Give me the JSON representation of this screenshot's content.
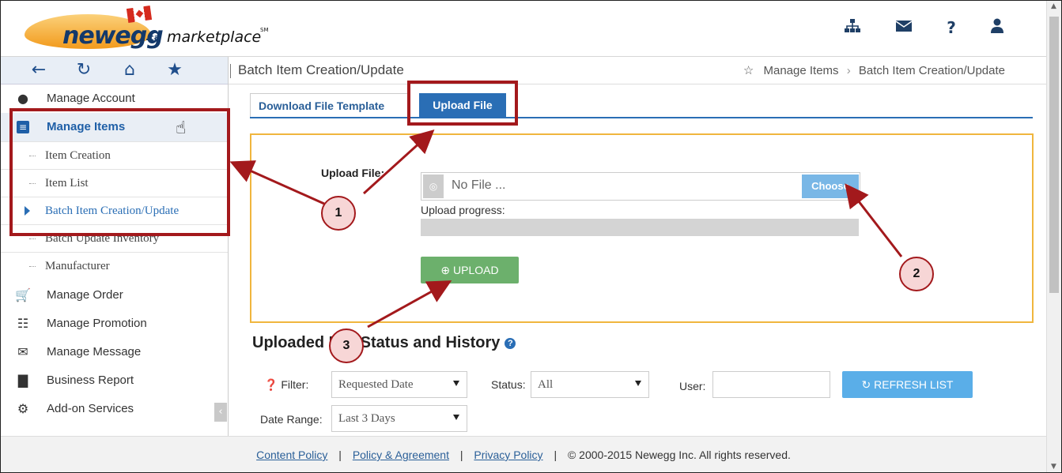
{
  "header": {
    "logo": {
      "brand": "newegg",
      "tld": ".ca",
      "product": "marketplace",
      "mark": "SM"
    },
    "icons": [
      "sitemap-icon",
      "envelope-icon",
      "help-icon",
      "user-icon"
    ]
  },
  "sidebar": {
    "nav_icons": [
      "back-icon",
      "refresh-icon",
      "home-icon",
      "star-icon"
    ],
    "menu": [
      {
        "label": "Manage Account",
        "icon": "user-icon"
      },
      {
        "label": "Manage Items",
        "icon": "list-icon",
        "active": true
      },
      {
        "label": "Manage Order",
        "icon": "cart-icon"
      },
      {
        "label": "Manage Promotion",
        "icon": "gift-icon"
      },
      {
        "label": "Manage Message",
        "icon": "envelope-icon"
      },
      {
        "label": "Business Report",
        "icon": "bar-chart-icon"
      },
      {
        "label": "Add-on Services",
        "icon": "cogs-icon"
      }
    ],
    "subitems": [
      {
        "label": "Item Creation"
      },
      {
        "label": "Item List"
      },
      {
        "label": "Batch Item Creation/Update",
        "current": true
      },
      {
        "label": "Batch Update Inventory"
      },
      {
        "label": "Manufacturer"
      }
    ]
  },
  "page": {
    "title": "Batch Item Creation/Update",
    "breadcrumb": [
      "Manage Items",
      "Batch Item Creation/Update"
    ]
  },
  "tabs": [
    {
      "label": "Download File Template",
      "active": false
    },
    {
      "label": "Upload File",
      "active": true
    }
  ],
  "upload": {
    "label": "Upload File:",
    "file_placeholder": "No File ...",
    "choose_label": "Choose",
    "progress_label": "Upload progress:",
    "progress": 0,
    "upload_button": "UPLOAD"
  },
  "history": {
    "title": "Uploaded File Status and History",
    "filter_label": "Filter:",
    "filter_value": "Requested Date",
    "status_label": "Status:",
    "status_value": "All",
    "user_label": "User:",
    "user_value": "",
    "refresh_label": "REFRESH LIST",
    "date_range_label": "Date Range:",
    "date_range_value": "Last 3 Days"
  },
  "footer": {
    "links": [
      "Content Policy",
      "Policy & Agreement",
      "Privacy Policy"
    ],
    "copyright": "© 2000-2015 Newegg Inc. All rights reserved."
  },
  "annotations": {
    "step1": "1",
    "step2": "2",
    "step3": "3"
  },
  "colors": {
    "brand_blue": "#2a6eb5",
    "highlight_red": "#a3191c",
    "panel_border": "#f0b63e",
    "upload_green": "#6cb06c"
  }
}
